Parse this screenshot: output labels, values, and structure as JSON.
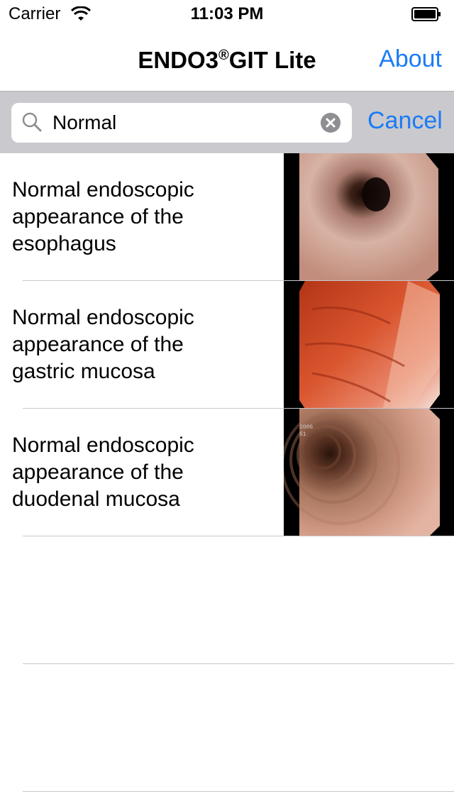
{
  "status_bar": {
    "carrier": "Carrier",
    "time": "11:03 PM"
  },
  "nav": {
    "title_main": "ENDO3",
    "title_mark": "®",
    "title_tail": "GIT Lite",
    "about_label": "About"
  },
  "search": {
    "value": "Normal",
    "cancel_label": "Cancel"
  },
  "results": [
    {
      "title": "Normal endoscopic\nappearance of the\nesophagus",
      "image": "esophagus-endoscopy-image"
    },
    {
      "title": "Normal endoscopic\nappearance of the\ngastric mucosa",
      "image": "gastric-mucosa-endoscopy-image"
    },
    {
      "title": "Normal endoscopic\nappearance of the\nduodenal mucosa",
      "image": "duodenal-mucosa-endoscopy-image",
      "overlay_text": [
        "2006",
        "51"
      ]
    }
  ],
  "colors": {
    "accent": "#1b7bf4",
    "search_bar_bg": "#c9c9ce",
    "separator": "#c8c7cc"
  }
}
